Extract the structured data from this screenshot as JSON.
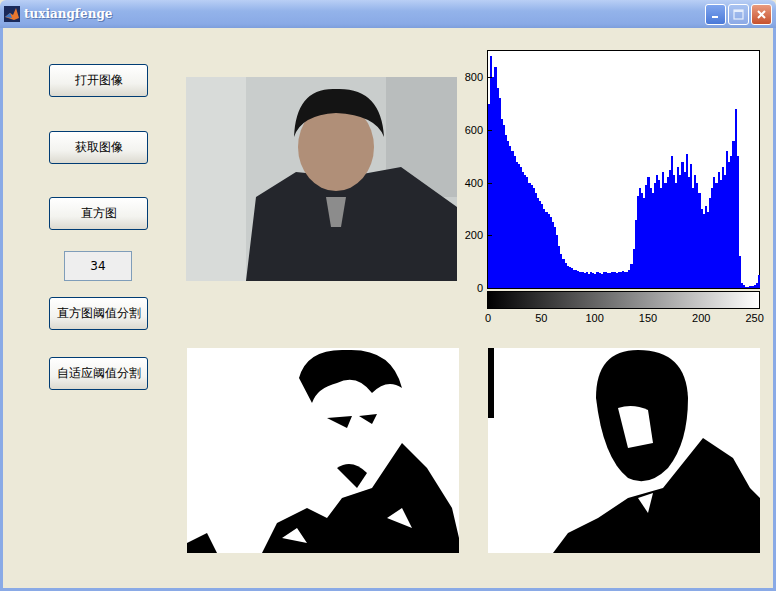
{
  "window": {
    "title": "tuxiangfenge"
  },
  "controls": [
    {
      "kind": "button",
      "label": "打开图像"
    },
    {
      "kind": "button",
      "label": "获取图像"
    },
    {
      "kind": "button",
      "label": "直方图"
    },
    {
      "kind": "edit",
      "value": "34"
    },
    {
      "kind": "button",
      "label": "直方图阈值分割"
    },
    {
      "kind": "button",
      "label": "自适应阈值分割"
    }
  ],
  "histogram": {
    "y_ticks": [
      "0",
      "200",
      "400",
      "600",
      "800"
    ],
    "x_ticks": [
      "0",
      "50",
      "100",
      "150",
      "200",
      "250"
    ],
    "values": [
      700,
      880,
      800,
      840,
      760,
      720,
      640,
      620,
      580,
      560,
      540,
      520,
      500,
      480,
      470,
      460,
      440,
      430,
      420,
      400,
      390,
      380,
      360,
      340,
      330,
      320,
      300,
      290,
      280,
      270,
      250,
      230,
      200,
      160,
      130,
      110,
      95,
      85,
      80,
      75,
      70,
      68,
      65,
      60,
      62,
      58,
      60,
      55,
      62,
      58,
      55,
      60,
      58,
      54,
      62,
      60,
      56,
      58,
      62,
      60,
      58,
      62,
      60,
      64,
      60,
      62,
      70,
      90,
      150,
      260,
      350,
      380,
      360,
      340,
      390,
      420,
      380,
      360,
      400,
      430,
      410,
      380,
      440,
      400,
      420,
      450,
      500,
      430,
      400,
      460,
      430,
      480,
      440,
      510,
      420,
      470,
      380,
      430,
      400,
      360,
      300,
      280,
      310,
      290,
      340,
      380,
      420,
      400,
      440,
      410,
      460,
      430,
      520,
      480,
      500,
      560,
      680,
      500,
      120,
      20,
      10,
      5,
      5,
      8,
      6,
      10,
      20,
      50
    ]
  }
}
